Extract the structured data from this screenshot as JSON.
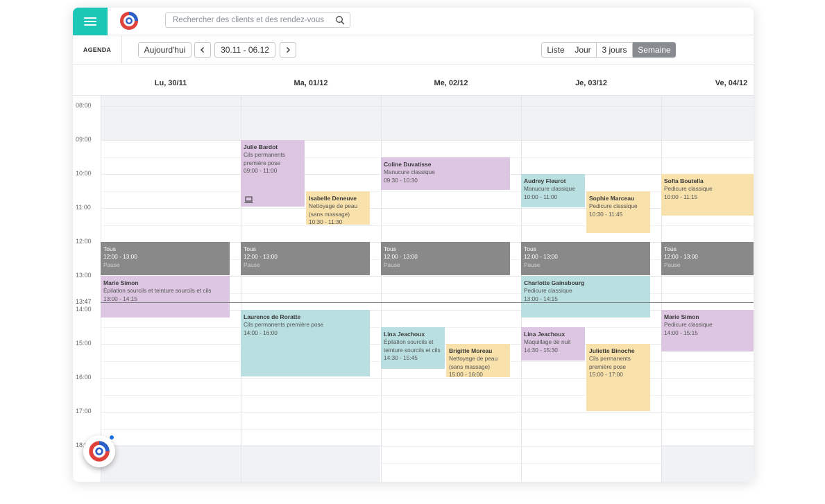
{
  "topbar": {
    "search_placeholder": "Rechercher des clients et des rendez-vous",
    "menu_icon": "hamburger-icon",
    "search_icon": "magnifier-icon",
    "brand_colors": {
      "teal": "#1cc7b6",
      "red": "#e0413a",
      "blue": "#2d5fc9"
    }
  },
  "toolbar": {
    "section_label": "AGENDA",
    "today_label": "Aujourd'hui",
    "date_range": "30.11 - 06.12",
    "views": [
      "Liste",
      "Jour",
      "3 jours",
      "Semaine"
    ],
    "active_view": "Semaine"
  },
  "calendar": {
    "days": [
      "Lu, 30/11",
      "Ma, 01/12",
      "Me, 02/12",
      "Je, 03/12",
      "Ve, 04/12"
    ],
    "hours": [
      "08:00",
      "09:00",
      "10:00",
      "11:00",
      "12:00",
      "13:00",
      "14:00",
      "15:00",
      "16:00",
      "17:00",
      "18:00"
    ],
    "current_time": "13:47",
    "colors": {
      "purple": "#dcc6e2",
      "orange": "#f8e1aa",
      "teal": "#b9dfe0",
      "pause": "#898989"
    },
    "events": {
      "mon": [
        {
          "title": "Tous",
          "time": "12:00 - 13:00",
          "note": "Pause"
        },
        {
          "title": "Marie Simon",
          "service": "Épilation sourcils et teinture sourcils et cils",
          "time": "13:00 - 14:15"
        }
      ],
      "tue": [
        {
          "title": "Julie Bardot",
          "service": "Cils permanents première pose",
          "time": "09:00 - 11:00",
          "icon": "laptop-icon"
        },
        {
          "title": "Isabelle Deneuve",
          "service": "Nettoyage de peau (sans massage)",
          "time": "10:30 - 11:30"
        },
        {
          "title": "Tous",
          "time": "12:00 - 13:00",
          "note": "Pause"
        },
        {
          "title": "Laurence de Roratte",
          "service": "Cils permanents première pose",
          "time": "14:00 - 16:00"
        }
      ],
      "wed": [
        {
          "title": "Coline Duvatisse",
          "service": "Manucure classique",
          "time": "09:30 - 10:30"
        },
        {
          "title": "Tous",
          "time": "12:00 - 13:00",
          "note": "Pause"
        },
        {
          "title": "Lina Jeachoux",
          "service": "Épilation sourcils et teinture sourcils et cils",
          "time": "14:30 - 15:45"
        },
        {
          "title": "Brigitte Moreau",
          "service": "Nettoyage de peau (sans massage)",
          "time": "15:00 - 16:00"
        }
      ],
      "thu": [
        {
          "title": "Audrey Fleurot",
          "service": "Manucure classique",
          "time": "10:00 - 11:00"
        },
        {
          "title": "Sophie Marceau",
          "service": "Pedicure classique",
          "time": "10:30 - 11:45"
        },
        {
          "title": "Tous",
          "time": "12:00 - 13:00",
          "note": "Pause"
        },
        {
          "title": "Charlotte Gainsbourg",
          "service": "Pedicure classique",
          "time": "13:00 - 14:15"
        },
        {
          "title": "Lina Jeachoux",
          "service": "Maquillage de nuit",
          "time": "14:30 - 15:30"
        },
        {
          "title": "Juliette Binoche",
          "service": "Cils permanents première pose",
          "time": "15:00 - 17:00"
        }
      ],
      "fri": [
        {
          "title": "Sofia Boutella",
          "service": "Pedicure classique",
          "time": "10:00 - 11:15"
        },
        {
          "title": "Tous",
          "time": "12:00 - 13:00",
          "note": "Pause"
        },
        {
          "title": "Marie Simon",
          "service": "Pedicure classique",
          "time": "14:00 - 15:15"
        }
      ]
    }
  }
}
